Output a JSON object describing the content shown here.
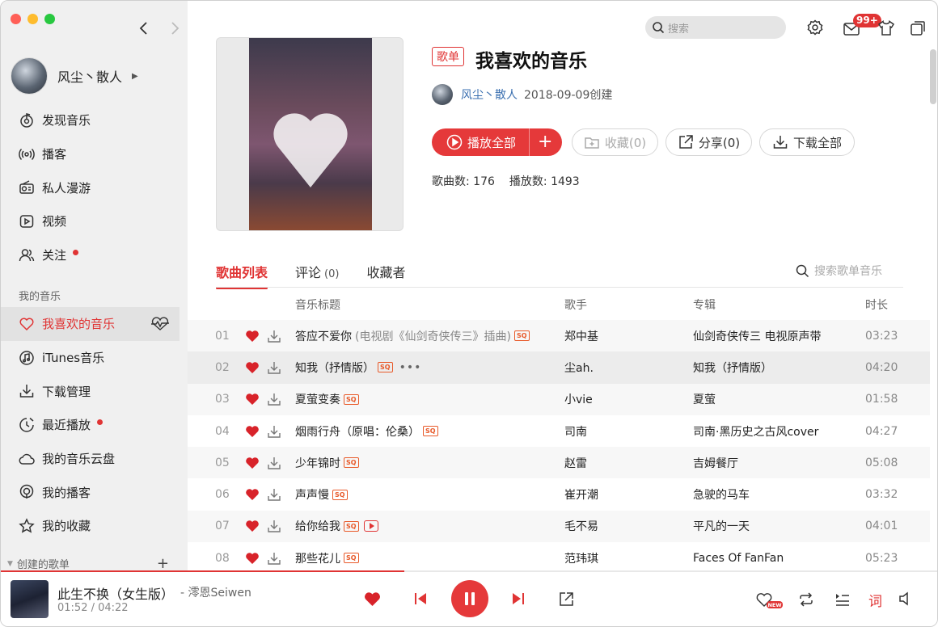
{
  "window": {
    "traffic_lights": [
      "#ff5f57",
      "#febc2e",
      "#28c840"
    ]
  },
  "topbar": {
    "search_placeholder": "搜索",
    "mail_badge": "99+"
  },
  "user": {
    "name": "风尘丶散人",
    "caret": "▶"
  },
  "sidebar": {
    "items": [
      {
        "label": "发现音乐",
        "icon": "music-note-icon"
      },
      {
        "label": "播客",
        "icon": "broadcast-icon"
      },
      {
        "label": "私人漫游",
        "icon": "radio-icon"
      },
      {
        "label": "视频",
        "icon": "video-icon"
      },
      {
        "label": "关注",
        "icon": "users-icon",
        "dot": true
      }
    ],
    "my_music_label": "我的音乐",
    "my_items": [
      {
        "label": "我喜欢的音乐",
        "icon": "heart-icon",
        "active": true
      },
      {
        "label": "iTunes音乐",
        "icon": "itunes-icon"
      },
      {
        "label": "下载管理",
        "icon": "download-icon"
      },
      {
        "label": "最近播放",
        "icon": "clock-icon",
        "dot": true
      },
      {
        "label": "我的音乐云盘",
        "icon": "cloud-icon"
      },
      {
        "label": "我的播客",
        "icon": "podcast-icon"
      },
      {
        "label": "我的收藏",
        "icon": "star-icon"
      }
    ],
    "created_label": "创建的歌单",
    "created_plus": "+"
  },
  "playlist": {
    "tag": "歌单",
    "title": "我喜欢的音乐",
    "creator": "风尘丶散人",
    "created": "2018-09-09创建",
    "play_all": "播放全部",
    "collect": "收藏(0)",
    "share": "分享(0)",
    "download_all": "下载全部",
    "song_count_label": "歌曲数:",
    "song_count": "176",
    "play_count_label": "播放数:",
    "play_count": "1493"
  },
  "tabs": [
    {
      "label": "歌曲列表",
      "count": ""
    },
    {
      "label": "评论",
      "count": "(0)"
    },
    {
      "label": "收藏者",
      "count": ""
    }
  ],
  "song_search_placeholder": "搜索歌单音乐",
  "table": {
    "headers": {
      "title": "音乐标题",
      "artist": "歌手",
      "album": "专辑",
      "duration": "时长"
    },
    "rows": [
      {
        "idx": "01",
        "title": "答应不爱你",
        "sub": "(电视剧《仙剑奇侠传三》插曲)",
        "sq": "SQ",
        "artist": "郑中基",
        "album": "仙剑奇侠传三 电视原声带",
        "dur": "03:23"
      },
      {
        "idx": "02",
        "title": "知我（抒情版）",
        "sub": "",
        "sq": "SQ",
        "more": "•••",
        "artist": "尘ah.",
        "album": "知我（抒情版）",
        "dur": "04:20"
      },
      {
        "idx": "03",
        "title": "夏萤变奏",
        "sub": "",
        "sq": "SQ",
        "artist": "小vie",
        "album": "夏萤",
        "dur": "01:58"
      },
      {
        "idx": "04",
        "title": "烟雨行舟（原唱：伦桑）",
        "sub": "",
        "sq": "SQ",
        "artist": "司南",
        "album": "司南·黑历史之古风cover",
        "dur": "04:27"
      },
      {
        "idx": "05",
        "title": "少年锦时",
        "sub": "",
        "sq": "SQ",
        "artist": "赵雷",
        "album": "吉姆餐厅",
        "dur": "05:08"
      },
      {
        "idx": "06",
        "title": "声声慢",
        "sub": "",
        "sq": "SQ",
        "artist": "崔开潮",
        "album": "急驶的马车",
        "dur": "03:32"
      },
      {
        "idx": "07",
        "title": "给你给我",
        "sub": "",
        "sq": "SQ",
        "mv": true,
        "artist": "毛不易",
        "album": "平凡的一天",
        "dur": "04:01"
      },
      {
        "idx": "08",
        "title": "那些花儿",
        "sub": "",
        "sq": "SQ",
        "artist": "范玮琪",
        "album": "Faces Of FanFan",
        "dur": "05:23"
      }
    ]
  },
  "player": {
    "title": "此生不换（女生版）",
    "artist": "- 澪恩Seiwen",
    "time": "01:52 / 04:22",
    "progress": 0.43,
    "lyric": "词"
  },
  "colors": {
    "accent": "#e03434",
    "sq": "#e85a2a",
    "link": "#3a6fb0"
  }
}
